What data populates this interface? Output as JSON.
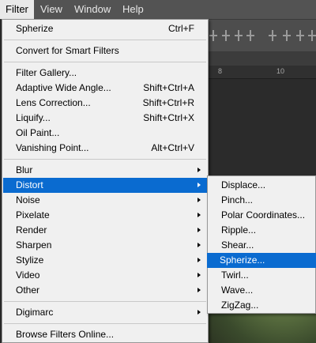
{
  "menubar": {
    "items": [
      "Filter",
      "View",
      "Window",
      "Help"
    ]
  },
  "filter_menu": {
    "sections": [
      [
        {
          "label": "Spherize",
          "shortcut": "Ctrl+F"
        }
      ],
      [
        {
          "label": "Convert for Smart Filters",
          "shortcut": ""
        }
      ],
      [
        {
          "label": "Filter Gallery...",
          "shortcut": ""
        },
        {
          "label": "Adaptive Wide Angle...",
          "shortcut": "Shift+Ctrl+A"
        },
        {
          "label": "Lens Correction...",
          "shortcut": "Shift+Ctrl+R"
        },
        {
          "label": "Liquify...",
          "shortcut": "Shift+Ctrl+X"
        },
        {
          "label": "Oil Paint...",
          "shortcut": ""
        },
        {
          "label": "Vanishing Point...",
          "shortcut": "Alt+Ctrl+V"
        }
      ],
      [
        {
          "label": "Blur",
          "submenu": true
        },
        {
          "label": "Distort",
          "submenu": true,
          "highlighted": true
        },
        {
          "label": "Noise",
          "submenu": true
        },
        {
          "label": "Pixelate",
          "submenu": true
        },
        {
          "label": "Render",
          "submenu": true
        },
        {
          "label": "Sharpen",
          "submenu": true
        },
        {
          "label": "Stylize",
          "submenu": true
        },
        {
          "label": "Video",
          "submenu": true
        },
        {
          "label": "Other",
          "submenu": true
        }
      ],
      [
        {
          "label": "Digimarc",
          "submenu": true
        }
      ],
      [
        {
          "label": "Browse Filters Online...",
          "shortcut": ""
        }
      ]
    ]
  },
  "distort_submenu": {
    "items": [
      "Displace...",
      "Pinch...",
      "Polar Coordinates...",
      "Ripple...",
      "Shear...",
      "Spherize...",
      "Twirl...",
      "Wave...",
      "ZigZag..."
    ],
    "highlighted_index": 5
  },
  "ruler": {
    "ticks": [
      "8",
      "10"
    ]
  },
  "colors": {
    "highlight": "#0a6bd0",
    "menu_bg": "#f0f0f0",
    "menubar_bg": "#535353"
  }
}
